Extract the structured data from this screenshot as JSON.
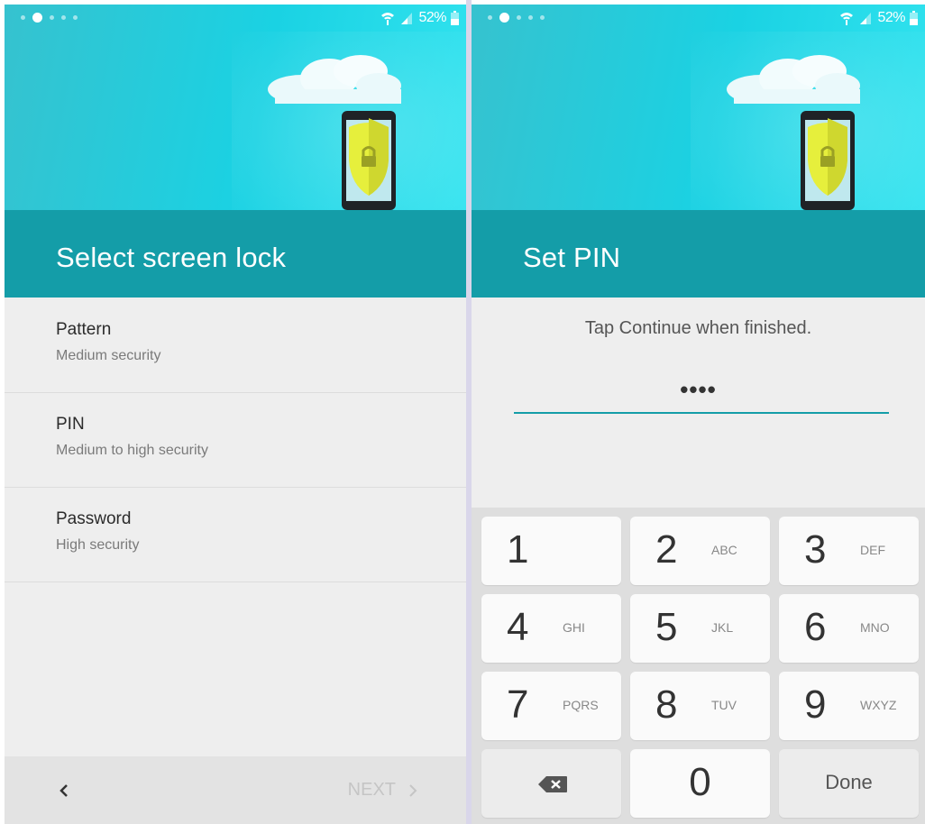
{
  "left_screen": {
    "status_bar": {
      "battery": "52%"
    },
    "title": "Select screen lock",
    "options": [
      {
        "label": "Pattern",
        "sublabel": "Medium security"
      },
      {
        "label": "PIN",
        "sublabel": "Medium to high security"
      },
      {
        "label": "Password",
        "sublabel": "High security"
      }
    ],
    "nav": {
      "back_icon": "chevron-left-icon",
      "next_label": "NEXT"
    }
  },
  "right_screen": {
    "status_bar": {
      "battery": "52%"
    },
    "title": "Set PIN",
    "instruction": "Tap Continue when finished.",
    "pin_field_value": "••••",
    "keypad": {
      "keys": [
        {
          "digit": "1",
          "letters": ""
        },
        {
          "digit": "2",
          "letters": "ABC"
        },
        {
          "digit": "3",
          "letters": "DEF"
        },
        {
          "digit": "4",
          "letters": "GHI"
        },
        {
          "digit": "5",
          "letters": "JKL"
        },
        {
          "digit": "6",
          "letters": "MNO"
        },
        {
          "digit": "7",
          "letters": "PQRS"
        },
        {
          "digit": "8",
          "letters": "TUV"
        },
        {
          "digit": "9",
          "letters": "WXYZ"
        },
        {
          "digit": "0",
          "letters": ""
        }
      ],
      "backspace_icon": "backspace-icon",
      "done_label": "Done"
    }
  },
  "colors": {
    "hero_gradient_start": "#36c2cf",
    "hero_gradient_end": "#32e3ef",
    "title_band": "#149da8",
    "accent": "#149da8",
    "shield": "#e6ef3c"
  }
}
